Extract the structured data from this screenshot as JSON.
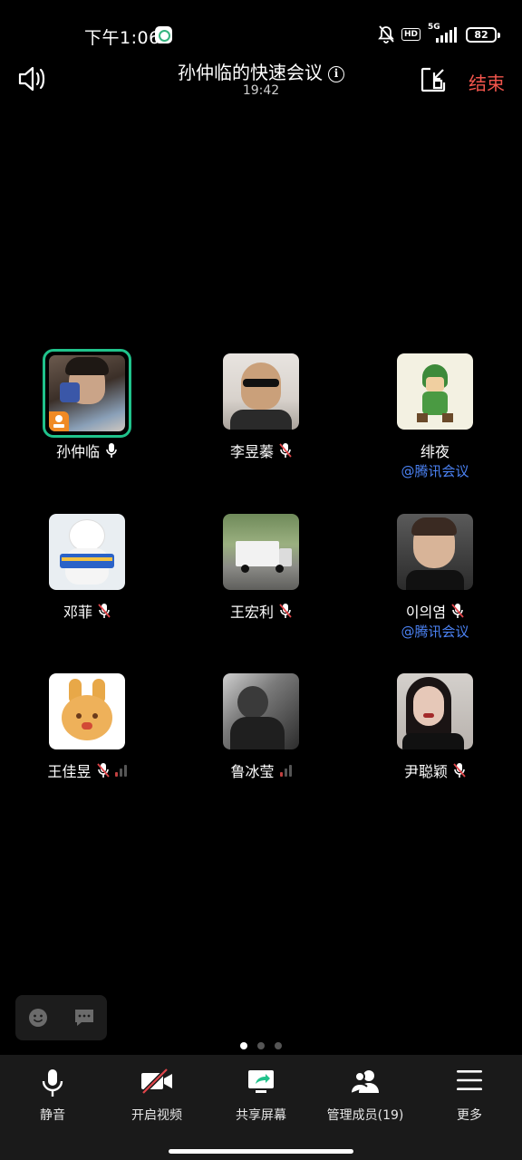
{
  "status_bar": {
    "time": "下午1:06",
    "hd": "HD",
    "network": "5G",
    "battery": "82"
  },
  "header": {
    "title": "孙仲临的快速会议",
    "timer": "19:42",
    "end_label": "结束"
  },
  "participants": [
    {
      "name": "孙仲临",
      "mic": "on",
      "host": true,
      "active_speaker": true,
      "sub_label": ""
    },
    {
      "name": "李昱蓁",
      "mic": "muted",
      "sub_label": ""
    },
    {
      "name": "绯夜",
      "mic": "none",
      "sub_label": "@腾讯会议"
    },
    {
      "name": "邓菲",
      "mic": "muted",
      "sub_label": ""
    },
    {
      "name": "王宏利",
      "mic": "muted",
      "sub_label": ""
    },
    {
      "name": "이의염",
      "mic": "muted",
      "sub_label": "@腾讯会议"
    },
    {
      "name": "王佳昱",
      "mic": "muted",
      "signal": true,
      "sub_label": ""
    },
    {
      "name": "鲁冰莹",
      "mic": "none",
      "signal": true,
      "sub_label": ""
    },
    {
      "name": "尹聪颖",
      "mic": "muted",
      "sub_label": ""
    }
  ],
  "pager": {
    "pages": 3,
    "current": 1
  },
  "toolbar": {
    "mute_label": "静音",
    "video_label": "开启视频",
    "share_label": "共享屏幕",
    "members_label": "管理成员(19)",
    "more_label": "更多"
  },
  "colors": {
    "accent_green": "#20c28b",
    "end_red": "#f2554c",
    "link_blue": "#4b82f3",
    "muted_red": "#e0454a"
  },
  "icons": {
    "speaker": "speaker-icon",
    "info": "info-icon",
    "minimize": "minimize-window-icon",
    "emoji": "emoji-icon",
    "chat": "chat-icon",
    "mic": "microphone-icon",
    "video_off": "video-off-icon",
    "share": "share-screen-icon",
    "members": "members-icon",
    "more": "menu-icon"
  }
}
